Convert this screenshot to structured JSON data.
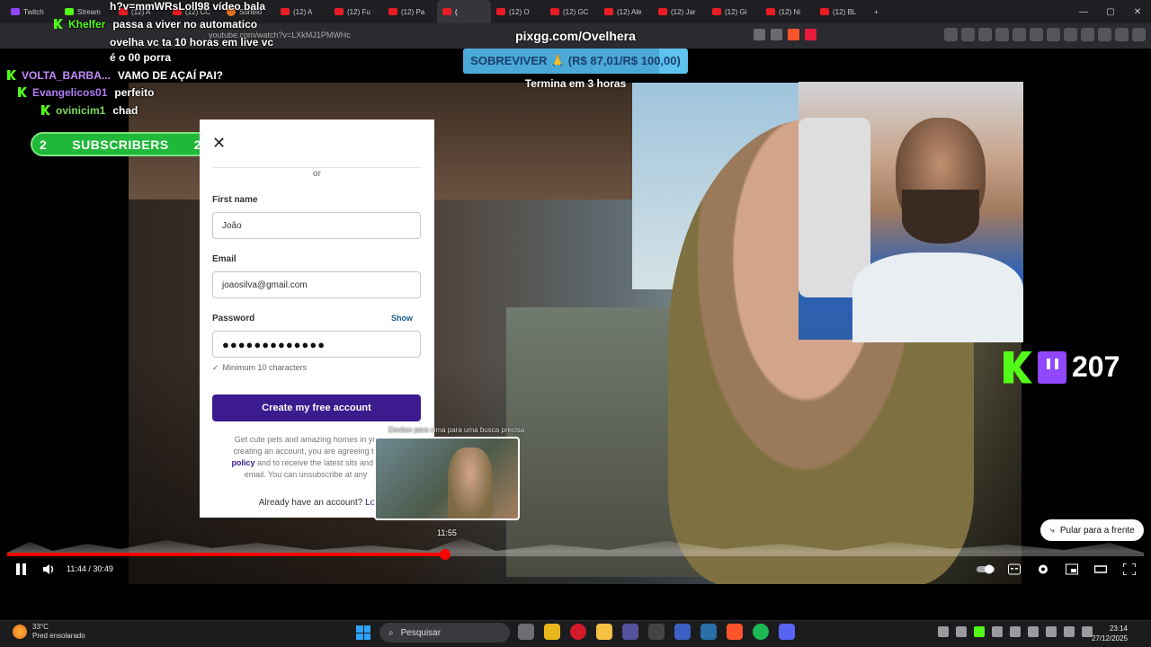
{
  "browser": {
    "tabs": [
      {
        "label": "Twitch",
        "icon": "twitch-icon"
      },
      {
        "label": "Stream",
        "icon": "kick-icon"
      },
      {
        "label": "(12) A",
        "icon": "youtube-icon"
      },
      {
        "label": "(12) CC",
        "icon": "youtube-icon"
      },
      {
        "label": "Sorteio",
        "icon": "sorteio-icon"
      },
      {
        "label": "(12) A",
        "icon": "youtube-icon"
      },
      {
        "label": "(12) Fu",
        "icon": "youtube-icon"
      },
      {
        "label": "(12) Pa",
        "icon": "youtube-icon"
      },
      {
        "label": "(",
        "icon": "youtube-icon",
        "active": true
      },
      {
        "label": "(12) O",
        "icon": "youtube-icon"
      },
      {
        "label": "(12) GC",
        "icon": "youtube-icon"
      },
      {
        "label": "(12) Ale",
        "icon": "youtube-icon"
      },
      {
        "label": "(12) Jar",
        "icon": "youtube-icon"
      },
      {
        "label": "(12) Gi",
        "icon": "youtube-icon"
      },
      {
        "label": "(12) Ni",
        "icon": "youtube-icon"
      },
      {
        "label": "(12) BL",
        "icon": "youtube-icon"
      }
    ],
    "new_tab": "+",
    "url": "youtube.com/watch?v=LXkMJ1PMWHc"
  },
  "overlay": {
    "pix_url": "pixgg.com/Ovelhera",
    "pix_goal": "SOBREVIVER 🙏 (R$ 87,01/R$ 100,00)",
    "pix_progress": 0.87,
    "timer": "Termina em 3 horas",
    "subs_left": "2",
    "subs_label": "SUBSCRIBERS",
    "subs_right": "2",
    "viewers": "207"
  },
  "chat": [
    {
      "user": "",
      "text": "h?v=mmWRsLoll98 vídeo bala"
    },
    {
      "user": "Khelfer",
      "text": "passa a viver no automatico"
    },
    {
      "user": "",
      "text": "ovelha vc ta 10 horas em live vc"
    },
    {
      "user": "",
      "text": "é o 00 porra"
    },
    {
      "user": "VOLTA_BARBA...",
      "text": "VAMO DE AÇAÍ PAI?"
    },
    {
      "user": "Evangelicos01",
      "text": "perfeito"
    },
    {
      "user": "ovinicim1",
      "text": "chad"
    }
  ],
  "signup": {
    "or": "or",
    "first_name_label": "First name",
    "first_name_value": "João",
    "email_label": "Email",
    "email_value": "joaosilva@gmail.com",
    "password_label": "Password",
    "show_label": "Show",
    "password_value": "●●●●●●●●●●●●●",
    "hint": "Minimum 10 characters",
    "cta": "Create my free account",
    "legal_1": "Get cute pets and amazing homes in yo",
    "legal_2": "creating an account, you are agreeing to",
    "legal_link": "policy",
    "legal_3": "and to receive the latest sits and d",
    "legal_4": "email. You can unsubscribe at any",
    "already": "Already have an account?",
    "login": "Lo"
  },
  "player": {
    "preview_hint": "Deslize para cima para uma busca precisa",
    "preview_time": "11:55",
    "skip_label": "Pular para a frente",
    "current": "11:44",
    "duration": "30:49",
    "progress": 0.385
  },
  "taskbar": {
    "temp": "33°C",
    "weather": "Pred ensolarado",
    "search": "Pesquisar",
    "time": "23:14",
    "date": "27/12/2025"
  },
  "colors": {
    "kick_green": "#53fc18",
    "twitch_purple": "#9146ff",
    "youtube_red": "#ff0000",
    "cta_purple": "#3b1b8e"
  }
}
